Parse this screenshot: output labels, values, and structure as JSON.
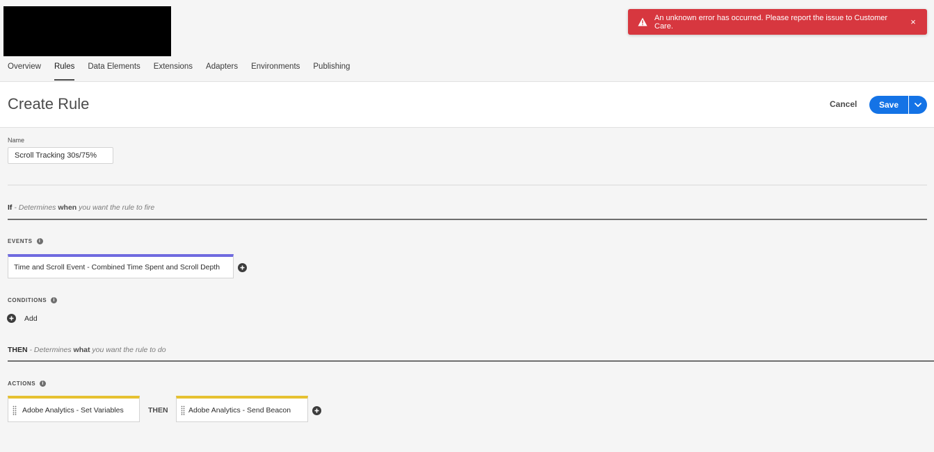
{
  "nav": {
    "tabs": [
      "Overview",
      "Rules",
      "Data Elements",
      "Extensions",
      "Adapters",
      "Environments",
      "Publishing"
    ],
    "active": "Rules"
  },
  "header": {
    "title": "Create Rule",
    "cancel_label": "Cancel",
    "save_label": "Save"
  },
  "toast": {
    "message": "An unknown error has occurred. Please report the issue to Customer Care.",
    "close_glyph": "×",
    "color": "#d7373f"
  },
  "form": {
    "name_label": "Name",
    "name_value": "Scroll Tracking 30s/75%"
  },
  "if_section": {
    "keyword": "If",
    "prefix": " - Determines ",
    "emph": "when",
    "suffix": " you want the rule to fire"
  },
  "events": {
    "label": "EVENTS",
    "items": [
      "Time and Scroll Event - Combined Time Spent and Scroll Depth"
    ],
    "color": "#6f6adf"
  },
  "conditions": {
    "label": "CONDITIONS",
    "add_label": "Add"
  },
  "then_section": {
    "keyword": "THEN",
    "prefix": " - Determines ",
    "emph": "what",
    "suffix": " you want the rule to do"
  },
  "actions": {
    "label": "ACTIONS",
    "items": [
      "Adobe Analytics - Set Variables",
      "Adobe Analytics - Send Beacon"
    ],
    "separator": "THEN",
    "color": "#e6c131"
  },
  "colors": {
    "accent": "#1473e6",
    "background": "#f5f5f5"
  }
}
